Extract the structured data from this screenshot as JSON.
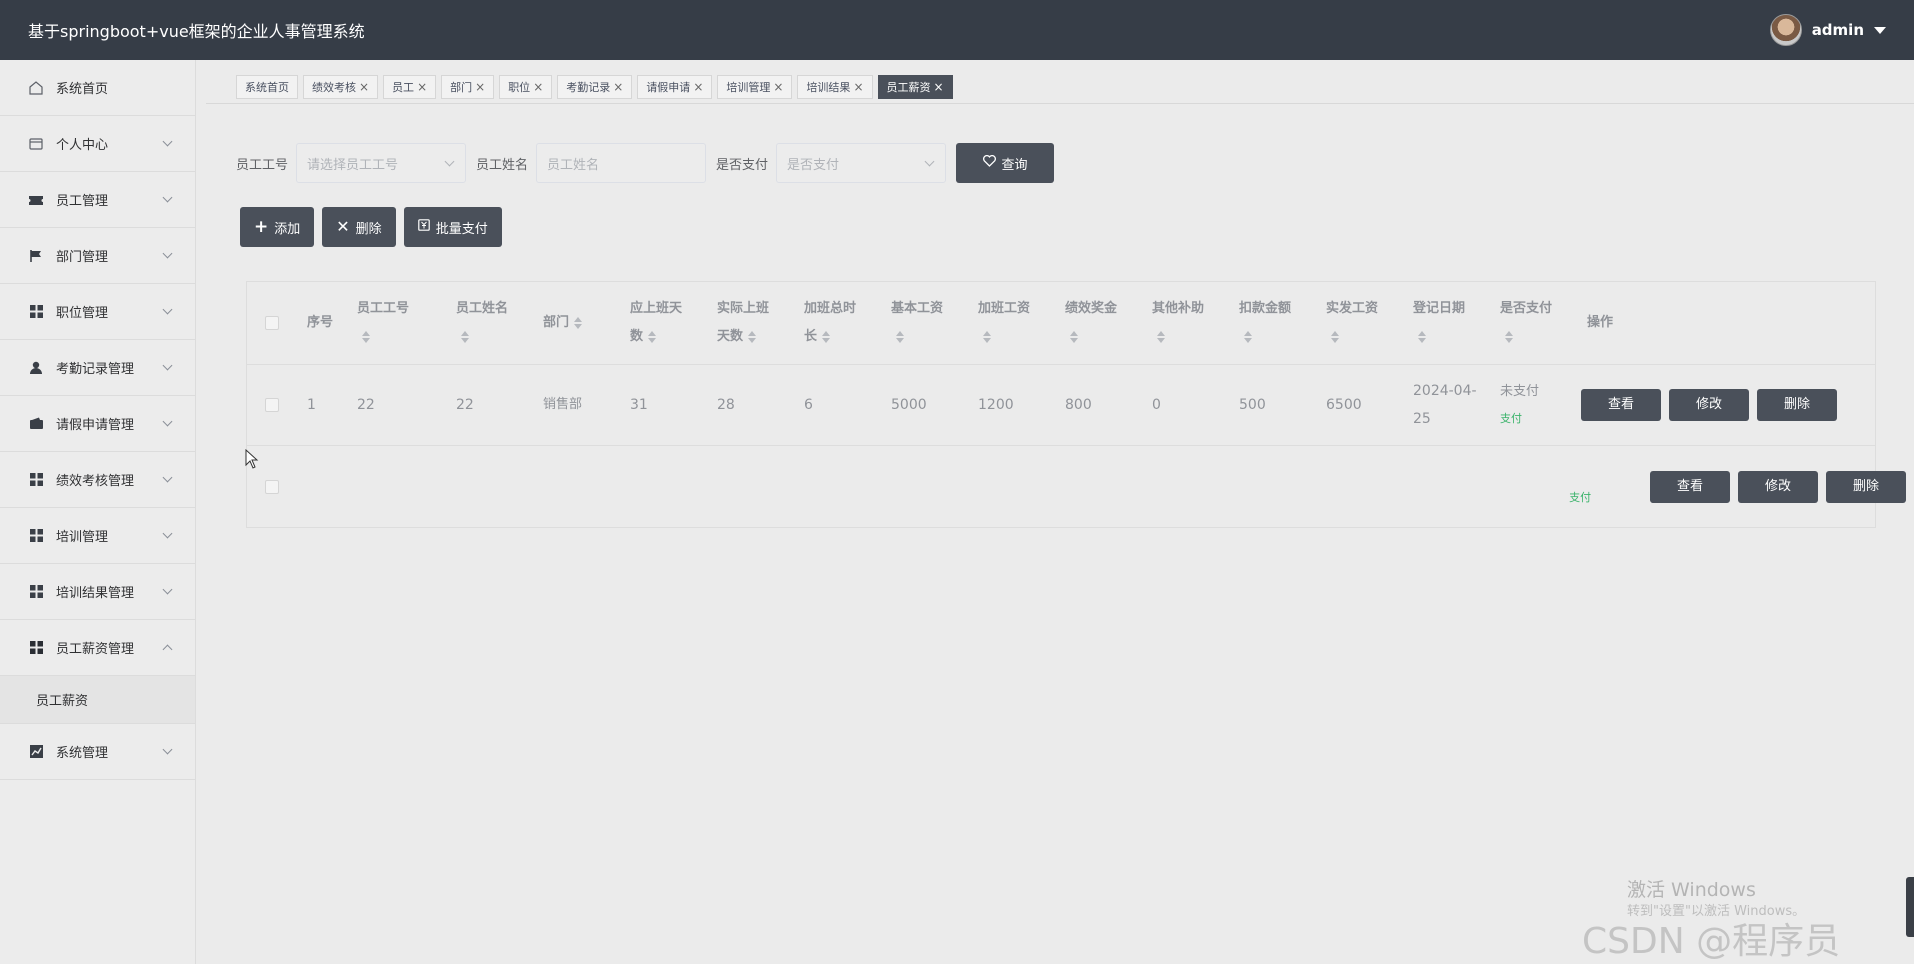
{
  "header": {
    "title": "基于springboot+vue框架的企业人事管理系统",
    "user": "admin"
  },
  "sidebar": {
    "items": [
      {
        "label": "系统首页",
        "icon": "home-icon"
      },
      {
        "label": "个人中心",
        "icon": "id-card-icon"
      },
      {
        "label": "员工管理",
        "icon": "ticket-icon"
      },
      {
        "label": "部门管理",
        "icon": "flag-icon"
      },
      {
        "label": "职位管理",
        "icon": "grid-icon"
      },
      {
        "label": "考勤记录管理",
        "icon": "user-icon"
      },
      {
        "label": "请假申请管理",
        "icon": "wallet-icon"
      },
      {
        "label": "绩效考核管理",
        "icon": "grid-icon"
      },
      {
        "label": "培训管理",
        "icon": "grid-icon"
      },
      {
        "label": "培训结果管理",
        "icon": "grid-icon"
      },
      {
        "label": "员工薪资管理",
        "icon": "grid-icon"
      },
      {
        "label": "员工薪资"
      },
      {
        "label": "系统管理",
        "icon": "chart-icon"
      }
    ]
  },
  "tags": [
    "系统首页",
    "绩效考核",
    "员工",
    "部门",
    "职位",
    "考勤记录",
    "请假申请",
    "培训管理",
    "培训结果",
    "员工薪资"
  ],
  "search": {
    "emp_no_label": "员工工号",
    "emp_no_placeholder": "请选择员工工号",
    "emp_name_label": "员工姓名",
    "emp_name_placeholder": "员工姓名",
    "paid_label": "是否支付",
    "paid_placeholder": "是否支付",
    "query_button": "查询"
  },
  "actions": {
    "add": "添加",
    "delete": "删除",
    "batch_pay": "批量支付"
  },
  "table": {
    "headers": {
      "seq": "序号",
      "emp_no": "员工工号",
      "emp_name": "员工姓名",
      "dept": "部门",
      "days_due_1": "应上班天",
      "days_due_2": "数",
      "days_act_1": "实际上班",
      "days_act_2": "天数",
      "ot_1": "加班总时",
      "ot_2": "长",
      "base": "基本工资",
      "ot_pay": "加班工资",
      "bonus": "绩效奖金",
      "allowance": "其他补助",
      "deduct": "扣款金额",
      "net": "实发工资",
      "date": "登记日期",
      "paid": "是否支付",
      "ops": "操作"
    },
    "rows": [
      {
        "seq": "1",
        "emp_no": "22",
        "emp_name": "22",
        "dept": "销售部",
        "days_due": "31",
        "days_act": "28",
        "ot": "6",
        "base": "5000",
        "ot_pay": "1200",
        "bonus": "800",
        "allowance": "0",
        "deduct": "500",
        "net": "6500",
        "date_1": "2024-04-",
        "date_2": "25",
        "paid_status": "未支付",
        "pay_link": "支付"
      },
      {
        "pay_link": "支付"
      }
    ],
    "op_view": "查看",
    "op_edit": "修改",
    "op_delete": "删除"
  },
  "watermark": {
    "activate": "激活 Windows",
    "activate_sub": "转到\"设置\"以激活 Windows。",
    "csdn": "CSDN @程序员code"
  },
  "colors": {
    "header_bg": "#363d47",
    "button_bg": "#4a505a",
    "paid_green": "#3bb36b"
  }
}
